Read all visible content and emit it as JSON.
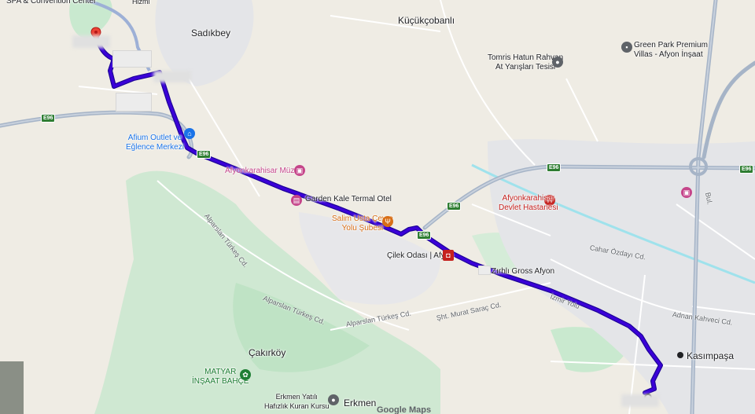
{
  "map": {
    "colors": {
      "background": "#efece4",
      "park": "#c9e9cf",
      "urban": "#e4e5e8",
      "road": "#ffffff",
      "highway": "#a6b4c7",
      "water": "#9fe2ec",
      "route": "#3b00d9",
      "route_outline": "#1d0099"
    },
    "labels": {
      "top_left_cut": "SPA & Convention Center",
      "top_fragment": "Hizmi",
      "sadikbey": "Sadıkbey",
      "kucukcobanli": "Küçükçobanlı",
      "tomris": "Tomris Hatun Rahvan\nAt Yarışları Tesisi",
      "greenpark": "Green Park Premium\nVillas - Afyon İnşaat",
      "afium": "Afium Outlet ve\nEğlence Merkezi",
      "muze": "Afyonkarahisar Müzesi",
      "garden": "Garden Kale Termal Otel",
      "salim": "Salim Usta Çevre\nYolu Şubesi",
      "devlet": "Afyonkarahisar\nDevlet Hastanesi",
      "cilek": "Çilek Odası | Afyon",
      "zirhli": "Zırhlı Gross Afyon",
      "cakirkoy": "Çakırköy",
      "matyar": "MATYAR\nİNŞAAT BAHÇE",
      "erkmen_kurs": "Erkmen Yatılı\nHafızlık Kuran Kursu",
      "erkmen": "Erkmen",
      "kasimpasa": "Kasımpaşa",
      "google_maps": "Google Maps"
    },
    "road_labels": {
      "alparslan1": "Alparslan Türkeş Cd.",
      "alparslan2": "Alparslan Türkeş Cd.",
      "murat": "Şht. Murat Saraç Cd.",
      "ozdayi": "Cahar Özdayı Cd.",
      "adnan": "Adnan Kahveci Cd.",
      "izmir": "İzmir Yolu",
      "bul": "Bul."
    },
    "shields": {
      "e96": "E96"
    }
  }
}
